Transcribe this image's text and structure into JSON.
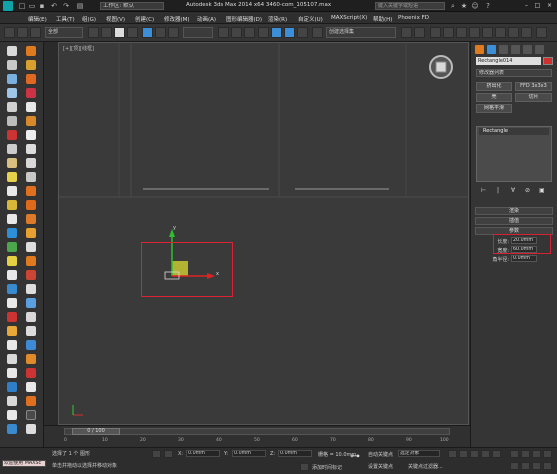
{
  "titlebar": {
    "workspace": "工作区: 默认",
    "title": "Autodesk 3ds Max  2014 x64    3460-com_105107.max",
    "search_placeholder": "键入关键字或短语"
  },
  "menu": [
    {
      "label": "编辑(E)"
    },
    {
      "label": "工具(T)"
    },
    {
      "label": "组(G)"
    },
    {
      "label": "视图(V)"
    },
    {
      "label": "创建(C)"
    },
    {
      "label": "修改器(M)"
    },
    {
      "label": "动画(A)"
    },
    {
      "label": "图形编辑器(D)"
    },
    {
      "label": "渲染(R)"
    },
    {
      "label": "自定义(U)"
    },
    {
      "label": "MAXScript(X)"
    },
    {
      "label": "帮助(H)"
    },
    {
      "label": "Phoenix FD"
    }
  ],
  "toolbar": {
    "filter": "全部",
    "selection_set": "创建选择集"
  },
  "viewport": {
    "label": "[+][顶][线框]"
  },
  "command_panel": {
    "object_name": "Rectangle014",
    "modifier_list": "修改器列表",
    "buttons": [
      "挤出化",
      "FFD 3x3x3",
      "壳",
      "切片",
      "网格平滑"
    ],
    "stack_item": "Rectangle",
    "rollouts": [
      "渲染",
      "插值",
      "参数"
    ],
    "params": [
      {
        "label": "长度:",
        "value": "20.0mm"
      },
      {
        "label": "宽度:",
        "value": "60.0mm"
      },
      {
        "label": "角半径:",
        "value": "0.0mm"
      }
    ]
  },
  "timeline": {
    "frame": "0 / 100",
    "ticks": [
      "0",
      "10",
      "20",
      "30",
      "40",
      "50",
      "60",
      "70",
      "80",
      "90",
      "100"
    ]
  },
  "status": {
    "welcome": "欢迎使用 MAXSc",
    "selected": "选择了 1 个 图形",
    "hint": "单击并拖动以选择并移动对象",
    "x": "0.0mm",
    "y": "0.0mm",
    "z": "0.0mm",
    "grid": "栅格 = 10.0mm",
    "autokey": "自动关键点",
    "selected_objects": "选定对象",
    "setkey": "设置关键点",
    "keyfilter": "关键点过滤器...",
    "add_time_tag": "添加时间标记"
  },
  "colors": {
    "accent": "#3c8fd6",
    "selection": "#d22233",
    "highlight": "#cf3030"
  }
}
